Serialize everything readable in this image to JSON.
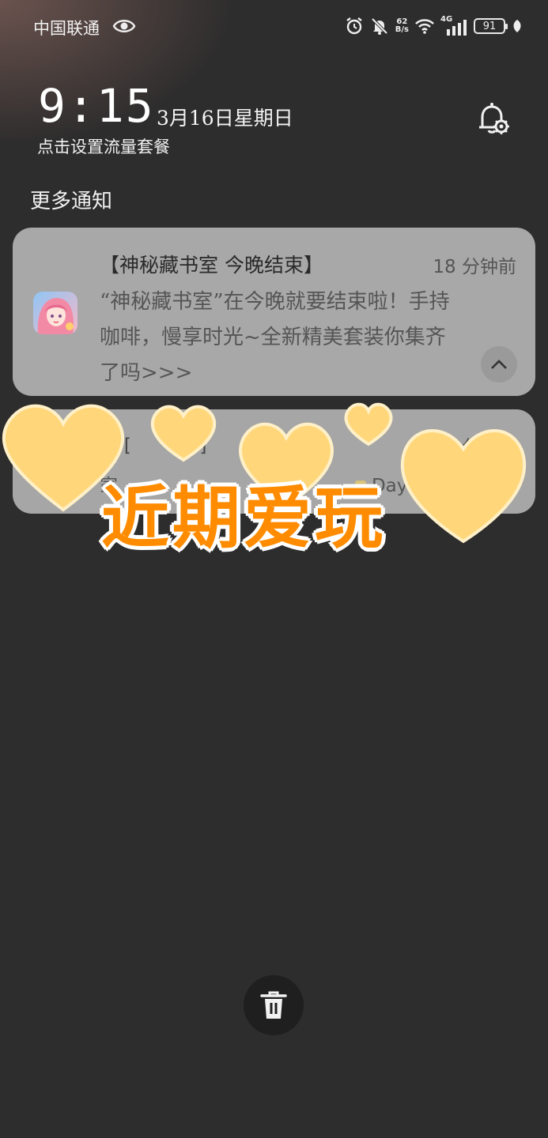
{
  "statusbar": {
    "carrier": "中国联通",
    "speed_value": "62",
    "speed_unit": "B/s",
    "network": "4G",
    "battery": "91"
  },
  "lockscreen": {
    "time": "9:15",
    "date": "3月16日星期日",
    "data_plan_hint": "点击设置流量套餐"
  },
  "notifications": {
    "section_title": "更多通知",
    "items": [
      {
        "title": "【神秘藏书室 今晚结束】",
        "time": "18 分钟前",
        "body": "“神秘藏书室”在今晚就要结束啦！手持咖啡，慢享时光~全新精美套装你集齐了吗>>>"
      },
      {
        "title_partial": "er [",
        "title_partial_end": "]",
        "time_partial": "分钟前",
        "body_partial_start": "家",
        "body_partial_end": "Day"
      }
    ]
  },
  "overlay": {
    "sticker_text": "近期爱玩"
  },
  "colors": {
    "background": "#2e2d2d",
    "card": "#a8a8a8",
    "sticker_orange": "#ff8c00",
    "heart_yellow": "#ffd77a"
  },
  "icons": [
    "eye-icon",
    "alarm-icon",
    "mute-bell-icon",
    "wifi-icon",
    "signal-icon",
    "leaf-icon",
    "bell-settings-icon",
    "chevron-up-icon",
    "trash-icon",
    "heart-icon"
  ]
}
